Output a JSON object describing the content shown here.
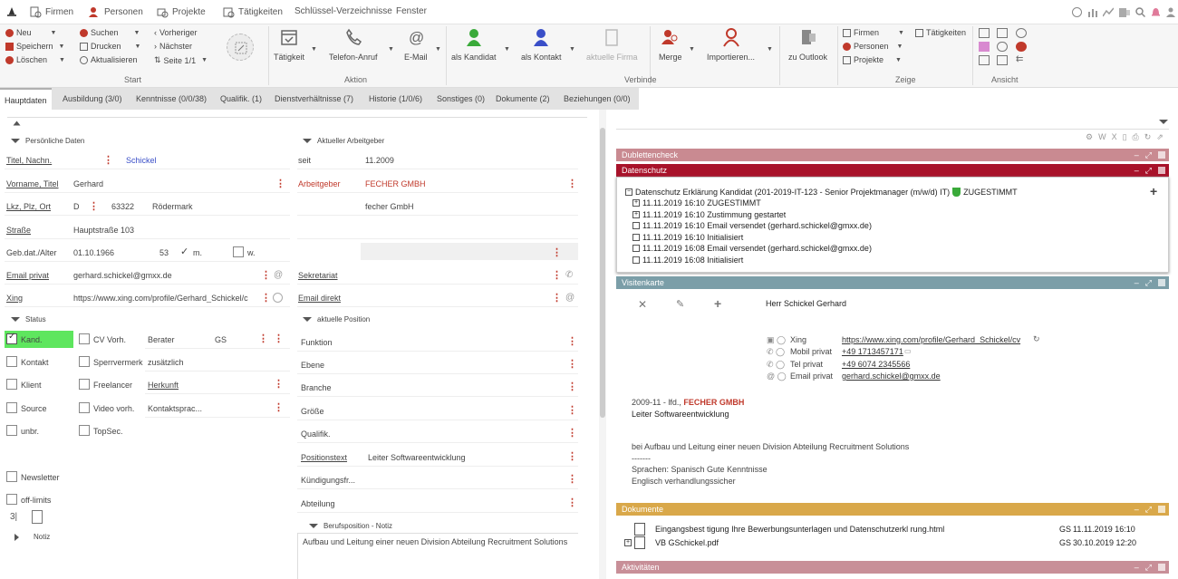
{
  "menubar": {
    "items": [
      {
        "label": "Firmen"
      },
      {
        "label": "Personen"
      },
      {
        "label": "Projekte"
      },
      {
        "label": "Tätigkeiten"
      },
      {
        "label": "Schlüssel-Verzeichnisse"
      },
      {
        "label": "Fenster"
      }
    ]
  },
  "ribbon": {
    "start": {
      "title": "Start",
      "neu": "Neu",
      "speichern": "Speichern",
      "loeschen": "Löschen",
      "suchen": "Suchen",
      "drucken": "Drucken",
      "aktualisieren": "Aktualisieren",
      "vorheriger": "Vorheriger",
      "naechster": "Nächster",
      "seite": "Seite 1/1"
    },
    "aktion": {
      "title": "Aktion",
      "taetigkeit": "Tätigkeit",
      "telefon": "Telefon-Anruf",
      "email": "E-Mail"
    },
    "verbinde": {
      "title": "Verbinde",
      "kandidat": "als Kandidat",
      "kontakt": "als Kontakt",
      "firma": "aktuelle Firma",
      "merge": "Merge",
      "importieren": "Importieren..."
    },
    "outlook": "zu Outlook",
    "zeige": {
      "title": "Zeige",
      "firmen": "Firmen",
      "personen": "Personen",
      "projekte": "Projekte",
      "taetigkeiten": "Tätigkeiten"
    },
    "ansicht": {
      "title": "Ansicht"
    }
  },
  "tabs": [
    "Hauptdaten",
    "Ausbildung (3/0)",
    "Kenntnisse (0/0/38)",
    "Qualifik. (1)",
    "Dienstverhältnisse (7)",
    "Historie (1/0/6)",
    "Sonstiges (0)",
    "Dokumente (2)",
    "Beziehungen (0/0)"
  ],
  "personal": {
    "section": "Persönliche Daten",
    "titel_label": "Titel, Nachn.",
    "nachname": "Schickel",
    "vorname_label": "Vorname, Titel",
    "vorname": "Gerhard",
    "lkz_label": "Lkz, Plz, Ort",
    "lkz": "D",
    "plz": "63322",
    "ort": "Rödermark",
    "strasse_label": "Straße",
    "strasse": "Hauptstraße 103",
    "geb_label": "Geb.dat./Alter",
    "geb": "01.10.1966",
    "alter": "53",
    "m": "m.",
    "w": "w.",
    "email_label": "Email privat",
    "email": "gerhard.schickel@gmxx.de",
    "xing_label": "Xing",
    "xing": "https://www.xing.com/profile/Gerhard_Schickel/c"
  },
  "employer": {
    "section": "Aktueller Arbeitgeber",
    "seit_label": "seit",
    "seit": "11.2009",
    "arbeitgeber_label": "Arbeitgeber",
    "arbeitgeber": "FECHER GMBH",
    "firma2": "fecher GmbH",
    "sekretariat_label": "Sekretariat",
    "email_direkt_label": "Email direkt"
  },
  "status": {
    "section": "Status",
    "kand": "Kand.",
    "cv": "CV Vorh.",
    "berater_label": "Berater",
    "berater": "GS",
    "kontakt": "Kontakt",
    "sperr": "Sperrvermerk",
    "zusaetzlich": "zusätzlich",
    "klient": "Klient",
    "freelancer": "Freelancer",
    "herkunft": "Herkunft",
    "source": "Source",
    "video": "Video vorh.",
    "kontaktsprache": "Kontaktsprac...",
    "unbr": "unbr.",
    "topsec": "TopSec.",
    "newsletter": "Newsletter",
    "offlimits": "off-limits",
    "notiz": "Notiz"
  },
  "position": {
    "section": "aktuelle Position",
    "funktion": "Funktion",
    "ebene": "Ebene",
    "branche": "Branche",
    "groesse": "Größe",
    "qualifik": "Qualifik.",
    "positionstext_label": "Positionstext",
    "positionstext": "Leiter Softwareentwicklung",
    "kuendigung": "Kündigungsfr...",
    "abteilung": "Abteilung",
    "notiz_section": "Berufsposition - Notiz",
    "notiz_text": "Aufbau und Leitung einer neuen Division Abteilung Recruitment Solutions"
  },
  "panels": {
    "dubletten": "Dublettencheck",
    "datenschutz": {
      "title": "Datenschutz",
      "root": "Datenschutz Erklärung Kandidat (201-2019-IT-123 - Senior Projektmanager (m/w/d) IT)",
      "root_status": "ZUGESTIMMT",
      "entries": [
        "11.11.2019 16:10 ZUGESTIMMT",
        "11.11.2019 16:10 Zustimmung gestartet",
        "11.11.2019 16:10 Email versendet (gerhard.schickel@gmxx.de)",
        "11.11.2019 16:10 Initialisiert",
        "11.11.2019 16:08 Email versendet (gerhard.schickel@gmxx.de)",
        "11.11.2019 16:08 Initialisiert"
      ]
    },
    "visitenkarte": {
      "title": "Visitenkarte",
      "name": "Herr Schickel Gerhard",
      "rows": [
        {
          "label": "Xing",
          "value": "https://www.xing.com/profile/Gerhard_Schickel/cv"
        },
        {
          "label": "Mobil privat",
          "value": "+49 1713457171"
        },
        {
          "label": "Tel privat",
          "value": "+49 6074 2345566"
        },
        {
          "label": "Email privat",
          "value": "gerhard.schickel@gmxx.de"
        }
      ],
      "job_period": "2009-11 - lfd.,",
      "job_company": "FECHER GMBH",
      "job_title": "Leiter Softwareentwicklung",
      "desc": "bei Aufbau und Leitung einer neuen Division Abteilung Recruitment Solutions",
      "dashes": "-------",
      "lang1": "Sprachen: Spanisch Gute Kenntnisse",
      "lang2": "Englisch verhandlungssicher"
    },
    "dokumente": {
      "title": "Dokumente",
      "files": [
        {
          "name": "Eingangsbest tigung Ihre Bewerbungsunterlagen und Datenschutzerkl rung.html",
          "user": "GS",
          "date": "11.11.2019 16:10"
        },
        {
          "name": "VB GSchickel.pdf",
          "user": "GS",
          "date": "30.10.2019 12:20"
        }
      ]
    },
    "aktivitaeten": "Aktivitäten"
  },
  "colors": {
    "datenschutz": "#a8122a",
    "dubletten": "#c98a91",
    "visitenkarte": "#7b9ea8",
    "dokumente": "#d9a84a",
    "aktivitaeten": "#c88f98",
    "kand_bg": "#5ee65e"
  }
}
